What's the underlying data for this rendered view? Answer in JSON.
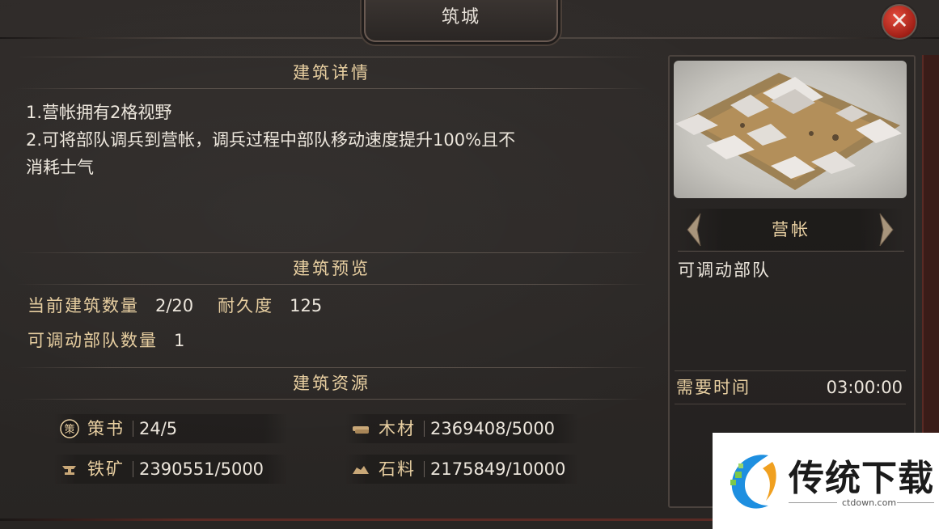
{
  "window": {
    "title": "筑城",
    "close_symbol": "✕"
  },
  "details": {
    "header": "建筑详情",
    "lines": [
      "1.营帐拥有2格视野",
      "2.可将部队调兵到营帐，调兵过程中部队移动速度提升100%且不",
      "消耗士气"
    ]
  },
  "preview": {
    "header": "建筑预览",
    "count_label": "当前建筑数量",
    "count_value": "2/20",
    "durability_label": "耐久度",
    "durability_value": "125",
    "troops_label": "可调动部队数量",
    "troops_value": "1"
  },
  "resources": {
    "header": "建筑资源",
    "items": [
      {
        "name": "策书",
        "value": "24/5",
        "icon": "book-seal-icon"
      },
      {
        "name": "木材",
        "value": "2369408/5000",
        "icon": "wood-icon"
      },
      {
        "name": "铁矿",
        "value": "2390551/5000",
        "icon": "anvil-icon"
      },
      {
        "name": "石料",
        "value": "2175849/10000",
        "icon": "stone-icon"
      }
    ]
  },
  "building": {
    "name": "营帐",
    "effect": "可调动部队",
    "time_label": "需要时间",
    "time_value": "03:00:00",
    "book_glyph": "策"
  },
  "watermark": {
    "text": "传统下载",
    "url": "ctdown.com"
  },
  "colors": {
    "gold_label": "#e8cfa1",
    "close_red": "#c0281c"
  }
}
